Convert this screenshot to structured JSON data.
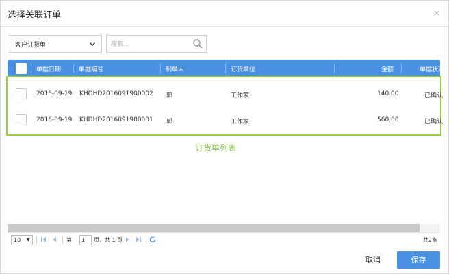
{
  "dialog": {
    "title": "选择关联订单",
    "close_glyph": "×"
  },
  "filter": {
    "select_value": "客户订货单",
    "search_placeholder": "搜索..."
  },
  "table": {
    "columns": [
      "单据日期",
      "单据编号",
      "制单人",
      "订货单位",
      "金额",
      "单据状态"
    ],
    "rows": [
      {
        "date": "2016-09-19",
        "code": "KHDHD2016091900002",
        "creator": "郭",
        "unit": "工作家",
        "amount": "140.00",
        "status": "已确认"
      },
      {
        "date": "2016-09-19",
        "code": "KHDHD2016091900001",
        "creator": "郭",
        "unit": "工作家",
        "amount": "560.00",
        "status": "已确认"
      }
    ]
  },
  "annotation": "订货单列表",
  "pager": {
    "page_size": "10",
    "page_prefix": "第",
    "page_value": "1",
    "page_suffix": "页，共 1 页",
    "total": "共2条"
  },
  "buttons": {
    "cancel": "取消",
    "save": "保存"
  },
  "icons": {
    "close": "close-icon",
    "dropdown": "chevron-down-icon",
    "search": "search-icon",
    "first": "first-page-icon",
    "prev": "prev-page-icon",
    "next": "next-page-icon",
    "last": "last-page-icon",
    "refresh": "refresh-icon"
  },
  "colors": {
    "header_blue": "#4a90e2",
    "highlight_green": "#9ccc3a",
    "annotation_green": "#8bc34a"
  }
}
